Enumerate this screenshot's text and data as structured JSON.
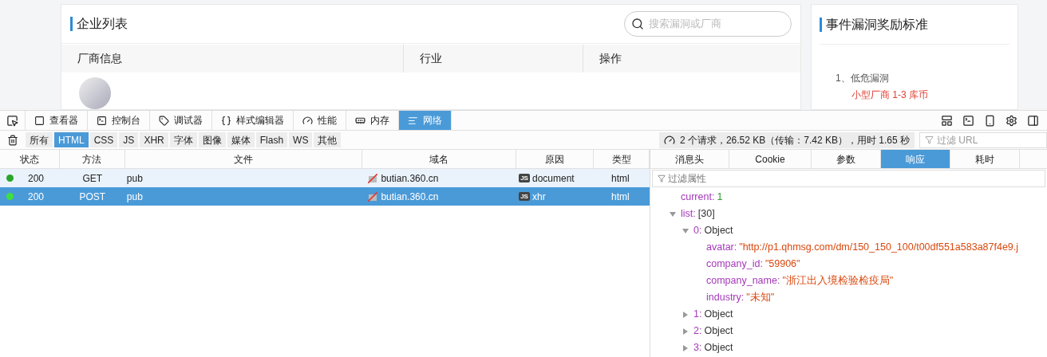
{
  "page": {
    "panel_title": "企业列表",
    "search_placeholder": "搜索漏洞或厂商",
    "columns": [
      "厂商信息",
      "行业",
      "操作"
    ],
    "side_title": "事件漏洞奖励标准",
    "side_items": [
      {
        "text": "1、低危漏洞",
        "kind": "heading"
      },
      {
        "text": "小型厂商 1-3 库币",
        "kind": "reward"
      }
    ]
  },
  "devtools": {
    "tools": [
      {
        "label": "查看器",
        "selected": false
      },
      {
        "label": "控制台",
        "selected": false
      },
      {
        "label": "调试器",
        "selected": false
      },
      {
        "label": "样式编辑器",
        "selected": false
      },
      {
        "label": "性能",
        "selected": false
      },
      {
        "label": "内存",
        "selected": false
      },
      {
        "label": "网络",
        "selected": true
      }
    ],
    "filters": [
      {
        "label": "所有",
        "selected": false
      },
      {
        "label": "HTML",
        "selected": true
      },
      {
        "label": "CSS",
        "selected": false
      },
      {
        "label": "JS",
        "selected": false
      },
      {
        "label": "XHR",
        "selected": false
      },
      {
        "label": "字体",
        "selected": false
      },
      {
        "label": "图像",
        "selected": false
      },
      {
        "label": "媒体",
        "selected": false
      },
      {
        "label": "Flash",
        "selected": false
      },
      {
        "label": "WS",
        "selected": false
      },
      {
        "label": "其他",
        "selected": false
      }
    ],
    "summary": "2 个请求，26.52 KB（传输：7.42 KB），用时 1.65 秒",
    "url_filter_placeholder": "过滤 URL",
    "columns": [
      "状态",
      "方法",
      "文件",
      "域名",
      "原因",
      "类型"
    ],
    "requests": [
      {
        "status": "200",
        "method": "GET",
        "file": "pub",
        "domain": "butian.360.cn",
        "cause_badge": "JS",
        "cause": "document",
        "type": "html",
        "selected": false
      },
      {
        "status": "200",
        "method": "POST",
        "file": "pub",
        "domain": "butian.360.cn",
        "cause_badge": "JS",
        "cause": "xhr",
        "type": "html",
        "selected": true
      }
    ],
    "detail_tabs": [
      {
        "label": "消息头",
        "selected": false
      },
      {
        "label": "Cookie",
        "selected": false
      },
      {
        "label": "参数",
        "selected": false
      },
      {
        "label": "响应",
        "selected": true
      },
      {
        "label": "耗时",
        "selected": false
      }
    ],
    "props_filter_placeholder": "过滤属性",
    "tree": [
      {
        "key": "current:",
        "value": "1",
        "kind": "number"
      },
      {
        "key": "list:",
        "value": "[30]",
        "kind": "array",
        "expanded": true,
        "children": [
          {
            "key": "0:",
            "value": "Object",
            "kind": "object",
            "expanded": true,
            "children": [
              {
                "key": "avatar:",
                "value": "\"http://p1.qhmsg.com/dm/150_150_100/t00df551a583a87f4e9.j",
                "kind": "string"
              },
              {
                "key": "company_id:",
                "value": "\"59906\"",
                "kind": "string"
              },
              {
                "key": "company_name:",
                "value": "\"浙江出入境检验检疫局\"",
                "kind": "string"
              },
              {
                "key": "industry:",
                "value": "\"未知\"",
                "kind": "string"
              }
            ]
          },
          {
            "key": "1:",
            "value": "Object",
            "kind": "object",
            "expanded": false
          },
          {
            "key": "2:",
            "value": "Object",
            "kind": "object",
            "expanded": false
          },
          {
            "key": "3:",
            "value": "Object",
            "kind": "object",
            "expanded": false
          }
        ]
      }
    ]
  }
}
